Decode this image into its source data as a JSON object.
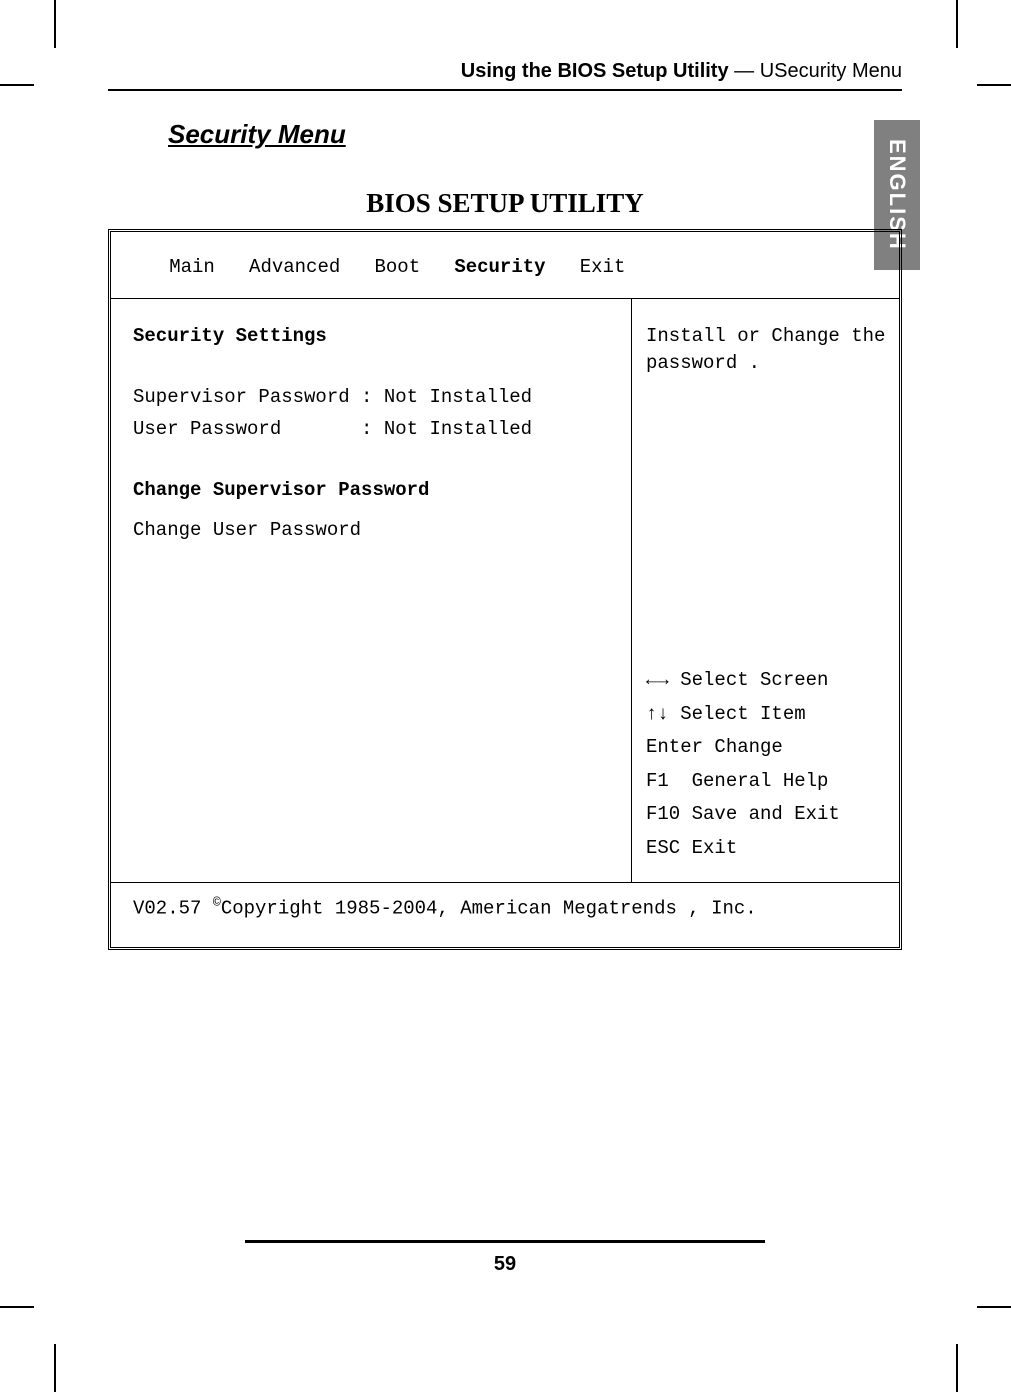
{
  "header": {
    "prefix_strong": "Using the BIOS Setup Utility",
    "separator": " — ",
    "suffix": "USecurity Menu"
  },
  "side_tab": "ENGLISH",
  "section_title": "Security Menu",
  "bios": {
    "title": "BIOS SETUP UTILITY",
    "menu": {
      "main": "Main",
      "advanced": "Advanced",
      "boot": "Boot",
      "security": "Security",
      "exit": "Exit"
    },
    "left": {
      "heading": "Security Settings",
      "sup_pw_label": "Supervisor Password : Not Installed",
      "user_pw_label": "User Password       : Not Installed",
      "change_sup": "Change Supervisor Password",
      "change_user": "Change User Password"
    },
    "right": {
      "help_text": "Install or Change the password .",
      "k_select_screen": "←→ Select Screen",
      "k_select_item": "↑↓ Select Item",
      "k_enter": "Enter Change",
      "k_f1": "F1  General Help",
      "k_f10": "F10 Save and Exit",
      "k_esc": "ESC Exit"
    },
    "footer_pre": "V02.57 ",
    "footer_copy": "©",
    "footer_post": "Copyright 1985-2004, American Megatrends , Inc."
  },
  "page_number": "59"
}
